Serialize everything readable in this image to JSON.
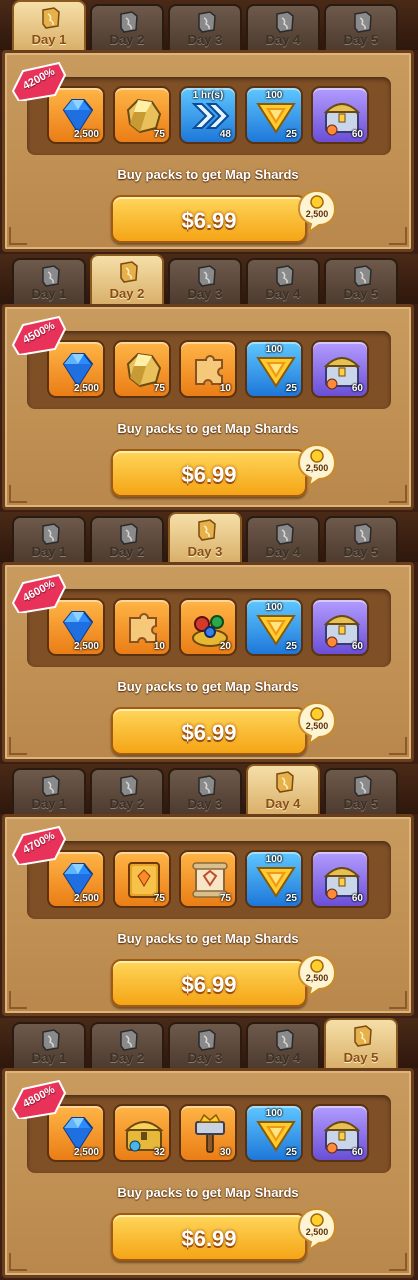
{
  "tabs": [
    "Day 1",
    "Day 2",
    "Day 3",
    "Day 4",
    "Day 5"
  ],
  "colors": {
    "panel": "#c99b5e",
    "button": "#f5a516",
    "badge": "#e8325a"
  },
  "packs": [
    {
      "active_tab": 0,
      "bonus": "4200%",
      "caption": "Buy packs to get Map Shards",
      "price": "$6.99",
      "shard_reward": "2,500",
      "items": [
        {
          "icon": "gem-icon",
          "bg": "orange",
          "qty": "2,500",
          "top": ""
        },
        {
          "icon": "gold-ore-icon",
          "bg": "orange",
          "qty": "75",
          "top": ""
        },
        {
          "icon": "speedup-icon",
          "bg": "blue",
          "qty": "48",
          "top": "1 hr(s)"
        },
        {
          "icon": "chevron-token-icon",
          "bg": "blue",
          "qty": "25",
          "top": "100"
        },
        {
          "icon": "treasure-chest-icon",
          "bg": "purple",
          "qty": "60",
          "top": ""
        }
      ]
    },
    {
      "active_tab": 1,
      "bonus": "4500%",
      "caption": "Buy packs to get Map Shards",
      "price": "$6.99",
      "shard_reward": "2,500",
      "items": [
        {
          "icon": "gem-icon",
          "bg": "orange",
          "qty": "2,500",
          "top": ""
        },
        {
          "icon": "gold-ore-icon",
          "bg": "orange",
          "qty": "75",
          "top": ""
        },
        {
          "icon": "puzzle-piece-icon",
          "bg": "orange",
          "qty": "10",
          "top": ""
        },
        {
          "icon": "chevron-token-icon",
          "bg": "blue",
          "qty": "25",
          "top": "100"
        },
        {
          "icon": "treasure-chest-icon",
          "bg": "purple",
          "qty": "60",
          "top": ""
        }
      ]
    },
    {
      "active_tab": 2,
      "bonus": "4600%",
      "caption": "Buy packs to get Map Shards",
      "price": "$6.99",
      "shard_reward": "2,500",
      "items": [
        {
          "icon": "gem-icon",
          "bg": "orange",
          "qty": "2,500",
          "top": ""
        },
        {
          "icon": "puzzle-piece-icon",
          "bg": "orange",
          "qty": "10",
          "top": ""
        },
        {
          "icon": "treasure-pile-icon",
          "bg": "orange",
          "qty": "20",
          "top": ""
        },
        {
          "icon": "chevron-token-icon",
          "bg": "blue",
          "qty": "25",
          "top": "100"
        },
        {
          "icon": "treasure-chest-icon",
          "bg": "purple",
          "qty": "60",
          "top": ""
        }
      ]
    },
    {
      "active_tab": 3,
      "bonus": "4700%",
      "caption": "Buy packs to get Map Shards",
      "price": "$6.99",
      "shard_reward": "2,500",
      "items": [
        {
          "icon": "gem-icon",
          "bg": "orange",
          "qty": "2,500",
          "top": ""
        },
        {
          "icon": "gem-book-icon",
          "bg": "orange",
          "qty": "75",
          "top": ""
        },
        {
          "icon": "gem-scroll-icon",
          "bg": "orange",
          "qty": "75",
          "top": ""
        },
        {
          "icon": "chevron-token-icon",
          "bg": "blue",
          "qty": "25",
          "top": "100"
        },
        {
          "icon": "treasure-chest-icon",
          "bg": "purple",
          "qty": "60",
          "top": ""
        }
      ]
    },
    {
      "active_tab": 4,
      "bonus": "4800%",
      "caption": "Buy packs to get Map Shards",
      "price": "$6.99",
      "shard_reward": "2,500",
      "items": [
        {
          "icon": "gem-icon",
          "bg": "orange",
          "qty": "2,500",
          "top": ""
        },
        {
          "icon": "golden-chest-icon",
          "bg": "orange",
          "qty": "32",
          "top": ""
        },
        {
          "icon": "crown-hammer-icon",
          "bg": "orange",
          "qty": "30",
          "top": ""
        },
        {
          "icon": "chevron-token-icon",
          "bg": "blue",
          "qty": "25",
          "top": "100"
        },
        {
          "icon": "treasure-chest-icon",
          "bg": "purple",
          "qty": "60",
          "top": ""
        }
      ]
    }
  ]
}
